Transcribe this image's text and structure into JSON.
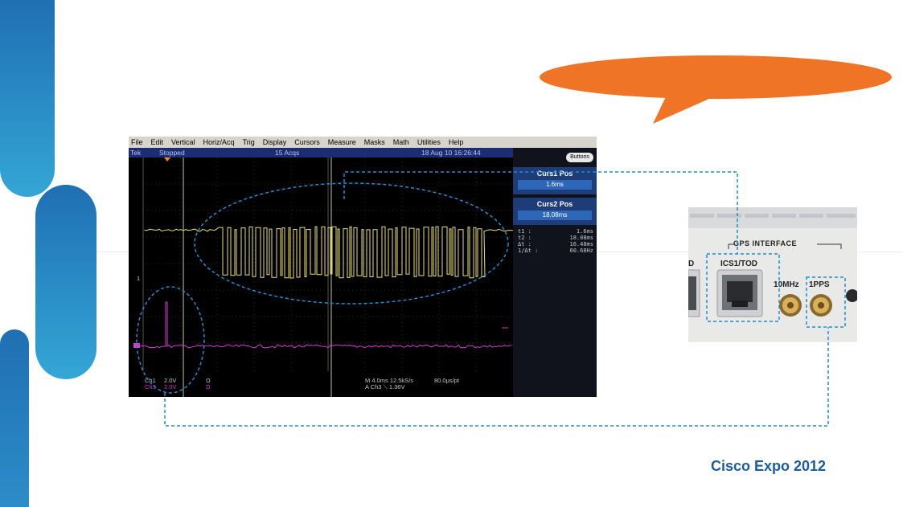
{
  "menu": [
    "File",
    "Edit",
    "Vertical",
    "Horiz/Acq",
    "Trig",
    "Display",
    "Cursors",
    "Measure",
    "Masks",
    "Math",
    "Utilities",
    "Help"
  ],
  "status": {
    "brand": "Tek",
    "state": "Stopped",
    "acqs": "15 Acqs",
    "datetime": "18 Aug 10 16:26:44"
  },
  "panel": {
    "buttons_label": "Buttons",
    "curs1": {
      "title": "Curs1 Pos",
      "value": "1.6ms"
    },
    "curs2": {
      "title": "Curs2 Pos",
      "value": "18.08ms"
    },
    "readout": [
      {
        "k": "t1 :",
        "v": "1.6ms"
      },
      {
        "k": "t2 :",
        "v": "18.08ms"
      },
      {
        "k": "Δt :",
        "v": "16.48ms"
      },
      {
        "k": "1/Δt :",
        "v": "60.68Hz"
      }
    ]
  },
  "scope_bottom": {
    "ch1": "Ch1",
    "ch1_scale": "2.0V",
    "ch1_unit": "Ω",
    "ch3": "Ch3",
    "ch3_scale": "2.0V",
    "ch3_unit": "Ω",
    "timebase": "M 4.0ms 12.5kS/s",
    "resolution": "80.0μs/pt",
    "trigger": "A  Ch3  ⟍  1.36V"
  },
  "ch1_marker": "1",
  "photo": {
    "gps": "GPS INTERFACE",
    "ics": "ICS1/TOD",
    "mhz": "10MHz",
    "pps": "1PPS",
    "d": "D"
  },
  "footer": "Cisco Expo 2012",
  "colors": {
    "accent_orange": "#ef7425",
    "brand_blue": "#1c5c9c",
    "trace_yellow": "#e8e070",
    "trace_magenta": "#d23bd2",
    "dashed_blue": "#1d8fd0"
  }
}
